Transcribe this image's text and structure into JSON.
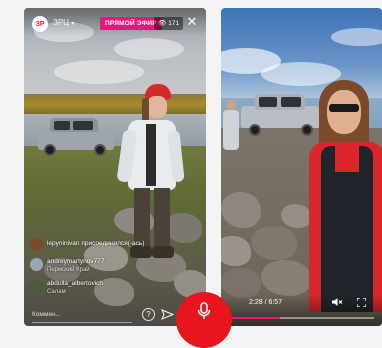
{
  "left_stream": {
    "channel_logo_text": "ЗР",
    "username": "ЗРЦ",
    "live_badge": "ПРЯМОЙ ЭФИР",
    "viewer_count": "171",
    "close_icon": "close-icon",
    "comments": [
      {
        "user": "lepyninivan",
        "text": "присоединился(-ась)",
        "avatar_color": "#7a4b2a"
      },
      {
        "user": "andreymartynov777",
        "text": "Пермский Край",
        "avatar_color": "#9aa6b0"
      },
      {
        "user": "abdulla_albertovich",
        "text": "Салам",
        "avatar_color": "#4a5a3a"
      }
    ],
    "comment_placeholder": "Коммен...",
    "question_icon": "question-icon",
    "send_icon": "send-icon"
  },
  "right_video": {
    "time": "2:28 / 6:57",
    "progress": 0.355,
    "volume_icon": "volume-muted-icon",
    "fullscreen_icon": "fullscreen-icon"
  },
  "fab": {
    "icon": "microphone-icon",
    "color": "#e8141e"
  },
  "colors": {
    "live_pink": "#e5197a",
    "brand_red": "#d81f2a"
  }
}
